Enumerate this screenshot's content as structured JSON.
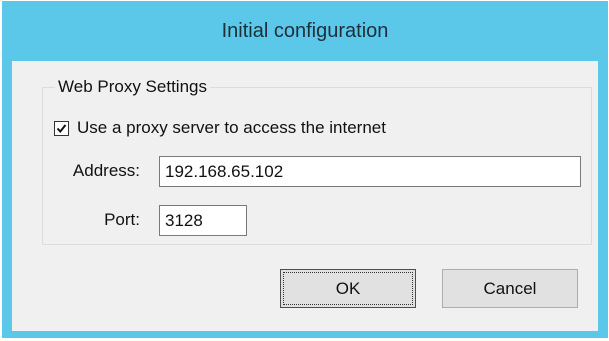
{
  "window": {
    "title": "Initial configuration"
  },
  "group": {
    "legend": "Web Proxy Settings",
    "use_proxy": {
      "label": "Use a proxy server to access the internet",
      "checked": true
    }
  },
  "address": {
    "label": "Address:",
    "value": "192.168.65.102"
  },
  "port": {
    "label": "Port:",
    "value": "3128"
  },
  "buttons": {
    "ok_label": "OK",
    "cancel_label": "Cancel"
  },
  "icons": {
    "checkbox_check": "checkmark-icon"
  },
  "colors": {
    "titlebar": "#5bc8ea",
    "client": "#f0f0f0"
  }
}
